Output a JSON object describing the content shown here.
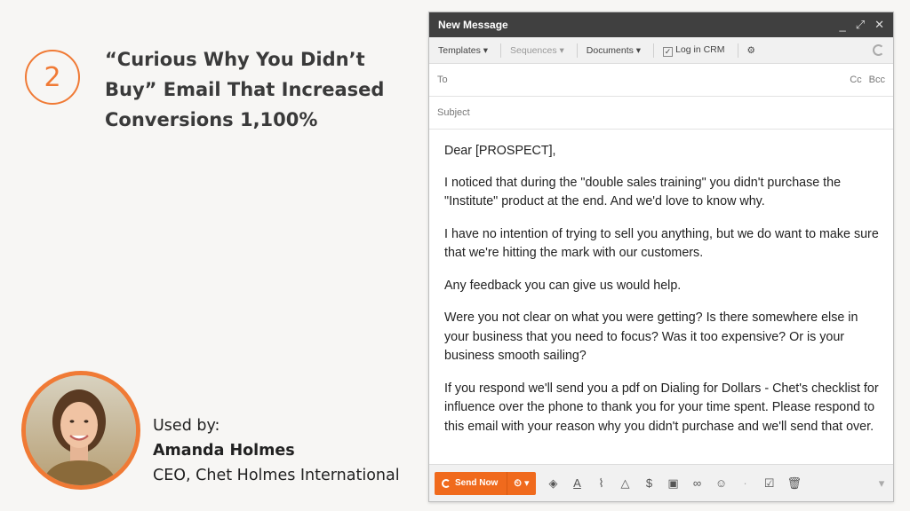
{
  "slide": {
    "number": "2",
    "headline": [
      "“Curious Why You Didn’t",
      "Buy” Email That Increased",
      "Conversions 1,100%"
    ],
    "used_by_label": "Used by:",
    "person_name": "Amanda Holmes",
    "person_title": "CEO, Chet Holmes International"
  },
  "email": {
    "window_title": "New Message",
    "window_controls": [
      "_",
      "⤢",
      "✕"
    ],
    "toolbar": {
      "templates": "Templates ▾",
      "sequences": "Sequences ▾",
      "documents": "Documents ▾",
      "log_in_crm": "Log in CRM",
      "log_in_crm_checked": true
    },
    "to_label": "To",
    "cc_label": "Cc",
    "bcc_label": "Bcc",
    "subject_label": "Subject",
    "body": [
      "Dear [PROSPECT],",
      "I noticed that during the \"double sales training\" you didn't purchase the \"Institute\" product at the end. And we'd love to know why.",
      "I have no intention of trying to sell you anything, but we do want to make sure that we're hitting the mark with our customers.",
      "Any feedback you can give us would help.",
      "Were you not clear on what you were getting? Is there somewhere else in your business that you need to focus? Was it too expensive? Or is your business smooth sailing?",
      "If you respond we'll send you a pdf on Dialing for Dollars - Chet's checklist for influence over the phone to thank you for your time spent. Please respond to this email with your reason why you didn't purchase and we'll send that over."
    ],
    "send_label": "Send Now",
    "accent_color": "#f06a1d"
  }
}
